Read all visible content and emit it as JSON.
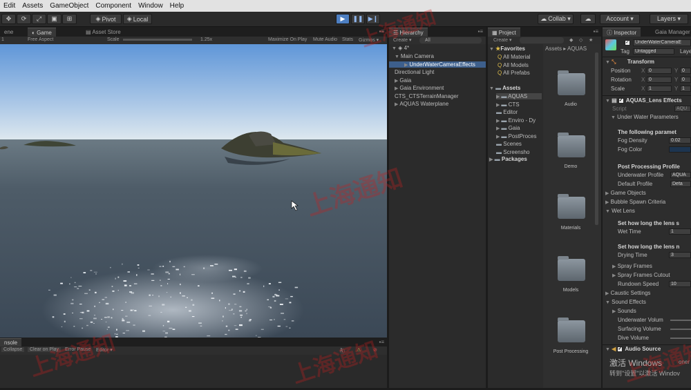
{
  "menu": [
    "Edit",
    "Assets",
    "GameObject",
    "Component",
    "Window",
    "Help"
  ],
  "toolbar": {
    "pivot": "Pivot",
    "local": "Local",
    "collab": "Collab ▾",
    "account": "Account ▾",
    "layers": "Layers ▾"
  },
  "game": {
    "tab_scene": "ene",
    "tab_game": "Game",
    "tab_asset_store": "Asset Store",
    "display": "1",
    "aspect": "Free Aspect",
    "scale_label": "Scale",
    "scale_value": "1.25x",
    "maximize": "Maximize On Play",
    "mute": "Mute Audio",
    "stats": "Stats",
    "gizmos": "Gizmos ▾"
  },
  "console": {
    "tab": "nsole",
    "collapse": "Collapse",
    "clear_on_play": "Clear on Play",
    "error_pause": "Error Pause",
    "editor": "Editor ▾",
    "error_count": "1"
  },
  "hierarchy": {
    "tab": "Hierarchy",
    "create": "Create ▾",
    "search": "All",
    "scene": "4*",
    "items": [
      {
        "label": "Main Camera",
        "indent": 1
      },
      {
        "label": "UnderWaterCameraEffects",
        "indent": 2,
        "selected": true
      },
      {
        "label": "Directional Light",
        "indent": 1
      },
      {
        "label": "Gaia",
        "indent": 1
      },
      {
        "label": "Gaia Environment",
        "indent": 1
      },
      {
        "label": "CTS_CTSTerrainManager",
        "indent": 1
      },
      {
        "label": "AQUAS Waterplane",
        "indent": 1
      }
    ]
  },
  "project": {
    "tab": "Project",
    "create": "Create ▾",
    "favorites_label": "Favorites",
    "favorites": [
      "All Material",
      "All Models",
      "All Prefabs"
    ],
    "assets_label": "Assets",
    "assets": [
      "AQUAS",
      "CTS",
      "Editor",
      "Enviro - Dy",
      "Gaia",
      "PostProces",
      "Scenes",
      "Screensho"
    ],
    "packages_label": "Packages",
    "breadcrumb": "Assets ▸ AQUAS",
    "folders": [
      "Audio",
      "Demo",
      "Materials",
      "Models",
      "Post Processing"
    ]
  },
  "inspector": {
    "tab_inspector": "Inspector",
    "tab_gaia": "Gaia Manager",
    "object_name": "UnderWaterCameraE",
    "tag_label": "Tag",
    "tag_value": "Untagged",
    "layer_label": "Laye",
    "transform_title": "Transform",
    "position_label": "Position",
    "rotation_label": "Rotation",
    "scale_label": "Scale",
    "position": {
      "x": "0",
      "y": "0"
    },
    "rotation": {
      "x": "0",
      "y": "0"
    },
    "scale": {
      "x": "1",
      "y": "1"
    },
    "component_title": "AQUAS_Lens Effects",
    "script_label": "Script",
    "script_value": "AQU",
    "under_water_params": "Under Water Parameters",
    "following_params": "The following paramet",
    "fog_density_label": "Fog Density",
    "fog_density_value": "0.02",
    "fog_color_label": "Fog Color",
    "post_processing_profiles": "Post Processing Profile",
    "underwater_profile_label": "Underwater Profile",
    "underwater_profile_value": "AQUA",
    "default_profile_label": "Default Profile",
    "default_profile_value": "Defa",
    "game_objects": "Game Objects",
    "bubble_spawn": "Bubble Spawn Criteria",
    "wet_lens": "Wet Lens",
    "set_how_long_1": "Set how long the lens s",
    "wet_time_label": "Wet Time",
    "wet_time_value": "1",
    "set_how_long_2": "Set how long the lens n",
    "drying_time_label": "Drying Time",
    "drying_time_value": "3",
    "spray_frames": "Spray Frames",
    "spray_frames_cutout": "Spray Frames Cutout",
    "rundown_speed_label": "Rundown Speed",
    "rundown_speed_value": "10",
    "caustic_settings": "Caustic Settings",
    "sound_effects": "Sound Effects",
    "sounds": "Sounds",
    "underwater_volume": "Underwater Volum",
    "surfacing_volume": "Surfacing Volume",
    "dive_volume": "Dive Volume",
    "audio_source": "Audio Source"
  },
  "activation": {
    "line1": "激活 Windows",
    "line2": "转到\"设置\"以激活 Windov",
    "peek": "oner"
  },
  "watermark": "上海通知",
  "colors": {
    "sky_top": "#5f96d8",
    "sky_bottom": "#dfe9ef",
    "sea": "#4a5866",
    "play_blue": "#4d7fc2",
    "selected_row": "#3d5f8c"
  }
}
